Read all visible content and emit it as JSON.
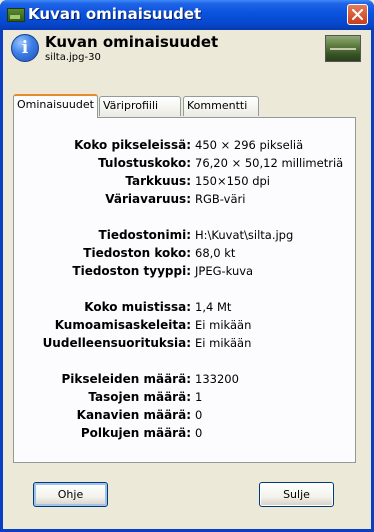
{
  "window": {
    "title": "Kuvan ominaisuudet"
  },
  "header": {
    "title": "Kuvan ominaisuudet",
    "subtitle": "silta.jpg-30"
  },
  "tabs": [
    {
      "label": "Ominaisuudet",
      "active": true
    },
    {
      "label": "Väriprofiili",
      "active": false
    },
    {
      "label": "Kommentti",
      "active": false
    }
  ],
  "properties": [
    {
      "label": "Koko pikseleissä:",
      "value": "450 × 296 pikseliä"
    },
    {
      "label": "Tulostuskoko:",
      "value": "76,20 × 50,12 millimetriä"
    },
    {
      "label": "Tarkkuus:",
      "value": "150×150 dpi"
    },
    {
      "label": "Väriavaruus:",
      "value": "RGB-väri"
    },
    {
      "label": "Tiedostonimi:",
      "value": "H:\\Kuvat\\silta.jpg"
    },
    {
      "label": "Tiedoston koko:",
      "value": "68,0 kt"
    },
    {
      "label": "Tiedoston tyyppi:",
      "value": "JPEG-kuva"
    },
    {
      "label": "Koko muistissa:",
      "value": "1,4 Mt"
    },
    {
      "label": "Kumoamisaskeleita:",
      "value": "Ei mikään"
    },
    {
      "label": "Uudelleensuorituksia:",
      "value": "Ei mikään"
    },
    {
      "label": "Pikseleiden määrä:",
      "value": "133200"
    },
    {
      "label": "Tasojen määrä:",
      "value": "1"
    },
    {
      "label": "Kanavien määrä:",
      "value": "0"
    },
    {
      "label": "Polkujen määrä:",
      "value": "0"
    }
  ],
  "buttons": {
    "help": "Ohje",
    "close": "Sulje"
  },
  "icons": {
    "app": "image-icon",
    "info": "info-icon",
    "close": "close-icon",
    "thumbnail": "image-thumbnail"
  },
  "colors": {
    "titlebar": "#0a52dd",
    "close_button": "#c73d1c",
    "active_tab_accent": "#e68b2c"
  }
}
